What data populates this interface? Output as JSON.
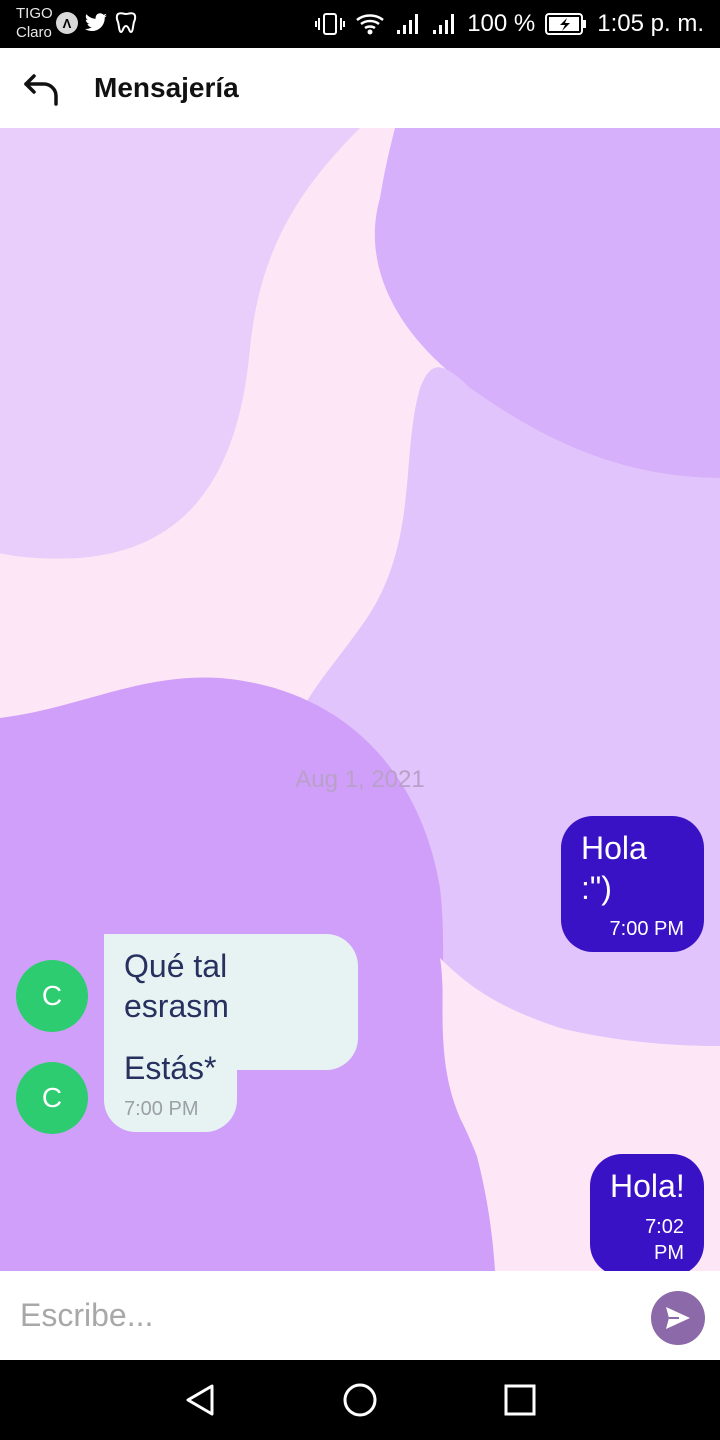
{
  "status_bar": {
    "carrier_1": "TIGO",
    "carrier_2": "Claro",
    "app_icon_letter": "Λ",
    "battery": "100 %",
    "time": "1:05 p. m."
  },
  "header": {
    "title": "Mensajería"
  },
  "chat": {
    "date_separator": "Aug 1, 2021",
    "messages": [
      {
        "direction": "outgoing",
        "text": "Hola :\")",
        "time": "7:00 PM"
      },
      {
        "direction": "incoming",
        "avatar": "C",
        "text": "Qué tal esrasm",
        "time": "7:00 PM"
      },
      {
        "direction": "incoming",
        "avatar": "C",
        "text": "Estás*",
        "time": "7:00 PM"
      },
      {
        "direction": "outgoing",
        "text": "Hola!",
        "time": "7:02 PM"
      }
    ]
  },
  "composer": {
    "placeholder": "Escribe..."
  },
  "colors": {
    "outgoing_bubble": "#3a12c6",
    "incoming_bubble": "#e6f3f2",
    "avatar": "#2ecc71",
    "send_button": "#8c69a8"
  }
}
